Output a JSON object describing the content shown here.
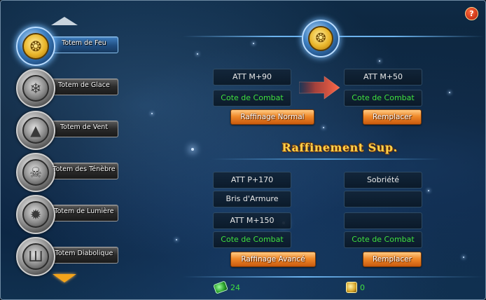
{
  "help": {
    "label": "?"
  },
  "sidebar": {
    "items": [
      {
        "label": "Totem de Feu",
        "glyph": "❂",
        "active": true
      },
      {
        "label": "Totem de Glace",
        "glyph": "❄",
        "active": false
      },
      {
        "label": "Totem de Vent",
        "glyph": "▲",
        "active": false
      },
      {
        "label": "Totem des Ténèbre",
        "glyph": "☠",
        "active": false
      },
      {
        "label": "Totem de Lumière",
        "glyph": "✹",
        "active": false
      },
      {
        "label": "Totem Diabolique",
        "glyph": "Ш",
        "active": false
      }
    ]
  },
  "emblem": {
    "glyph": "❂"
  },
  "normal": {
    "current": {
      "stat": "ATT M+90",
      "rating": "Cote de Combat"
    },
    "result": {
      "stat": "ATT M+50",
      "rating": "Cote de Combat"
    },
    "refine_button": "Raffinage Normal",
    "replace_button": "Remplacer"
  },
  "advanced": {
    "title": "Raffinement Sup.",
    "current": {
      "line1": "ATT P+170",
      "line2": "Bris d'Armure",
      "line3": "ATT M+150",
      "rating": "Cote de Combat"
    },
    "result": {
      "line1": "Sobriété",
      "line2": "",
      "line3": "",
      "rating": "Cote de Combat"
    },
    "refine_button": "Raffinage Avancé",
    "replace_button": "Remplacer"
  },
  "resources": {
    "gems": "24",
    "gold": "0"
  },
  "colors": {
    "accent_green": "#3fe03f",
    "button_orange": "#f08a2a",
    "title_gold": "#ffd24a"
  }
}
